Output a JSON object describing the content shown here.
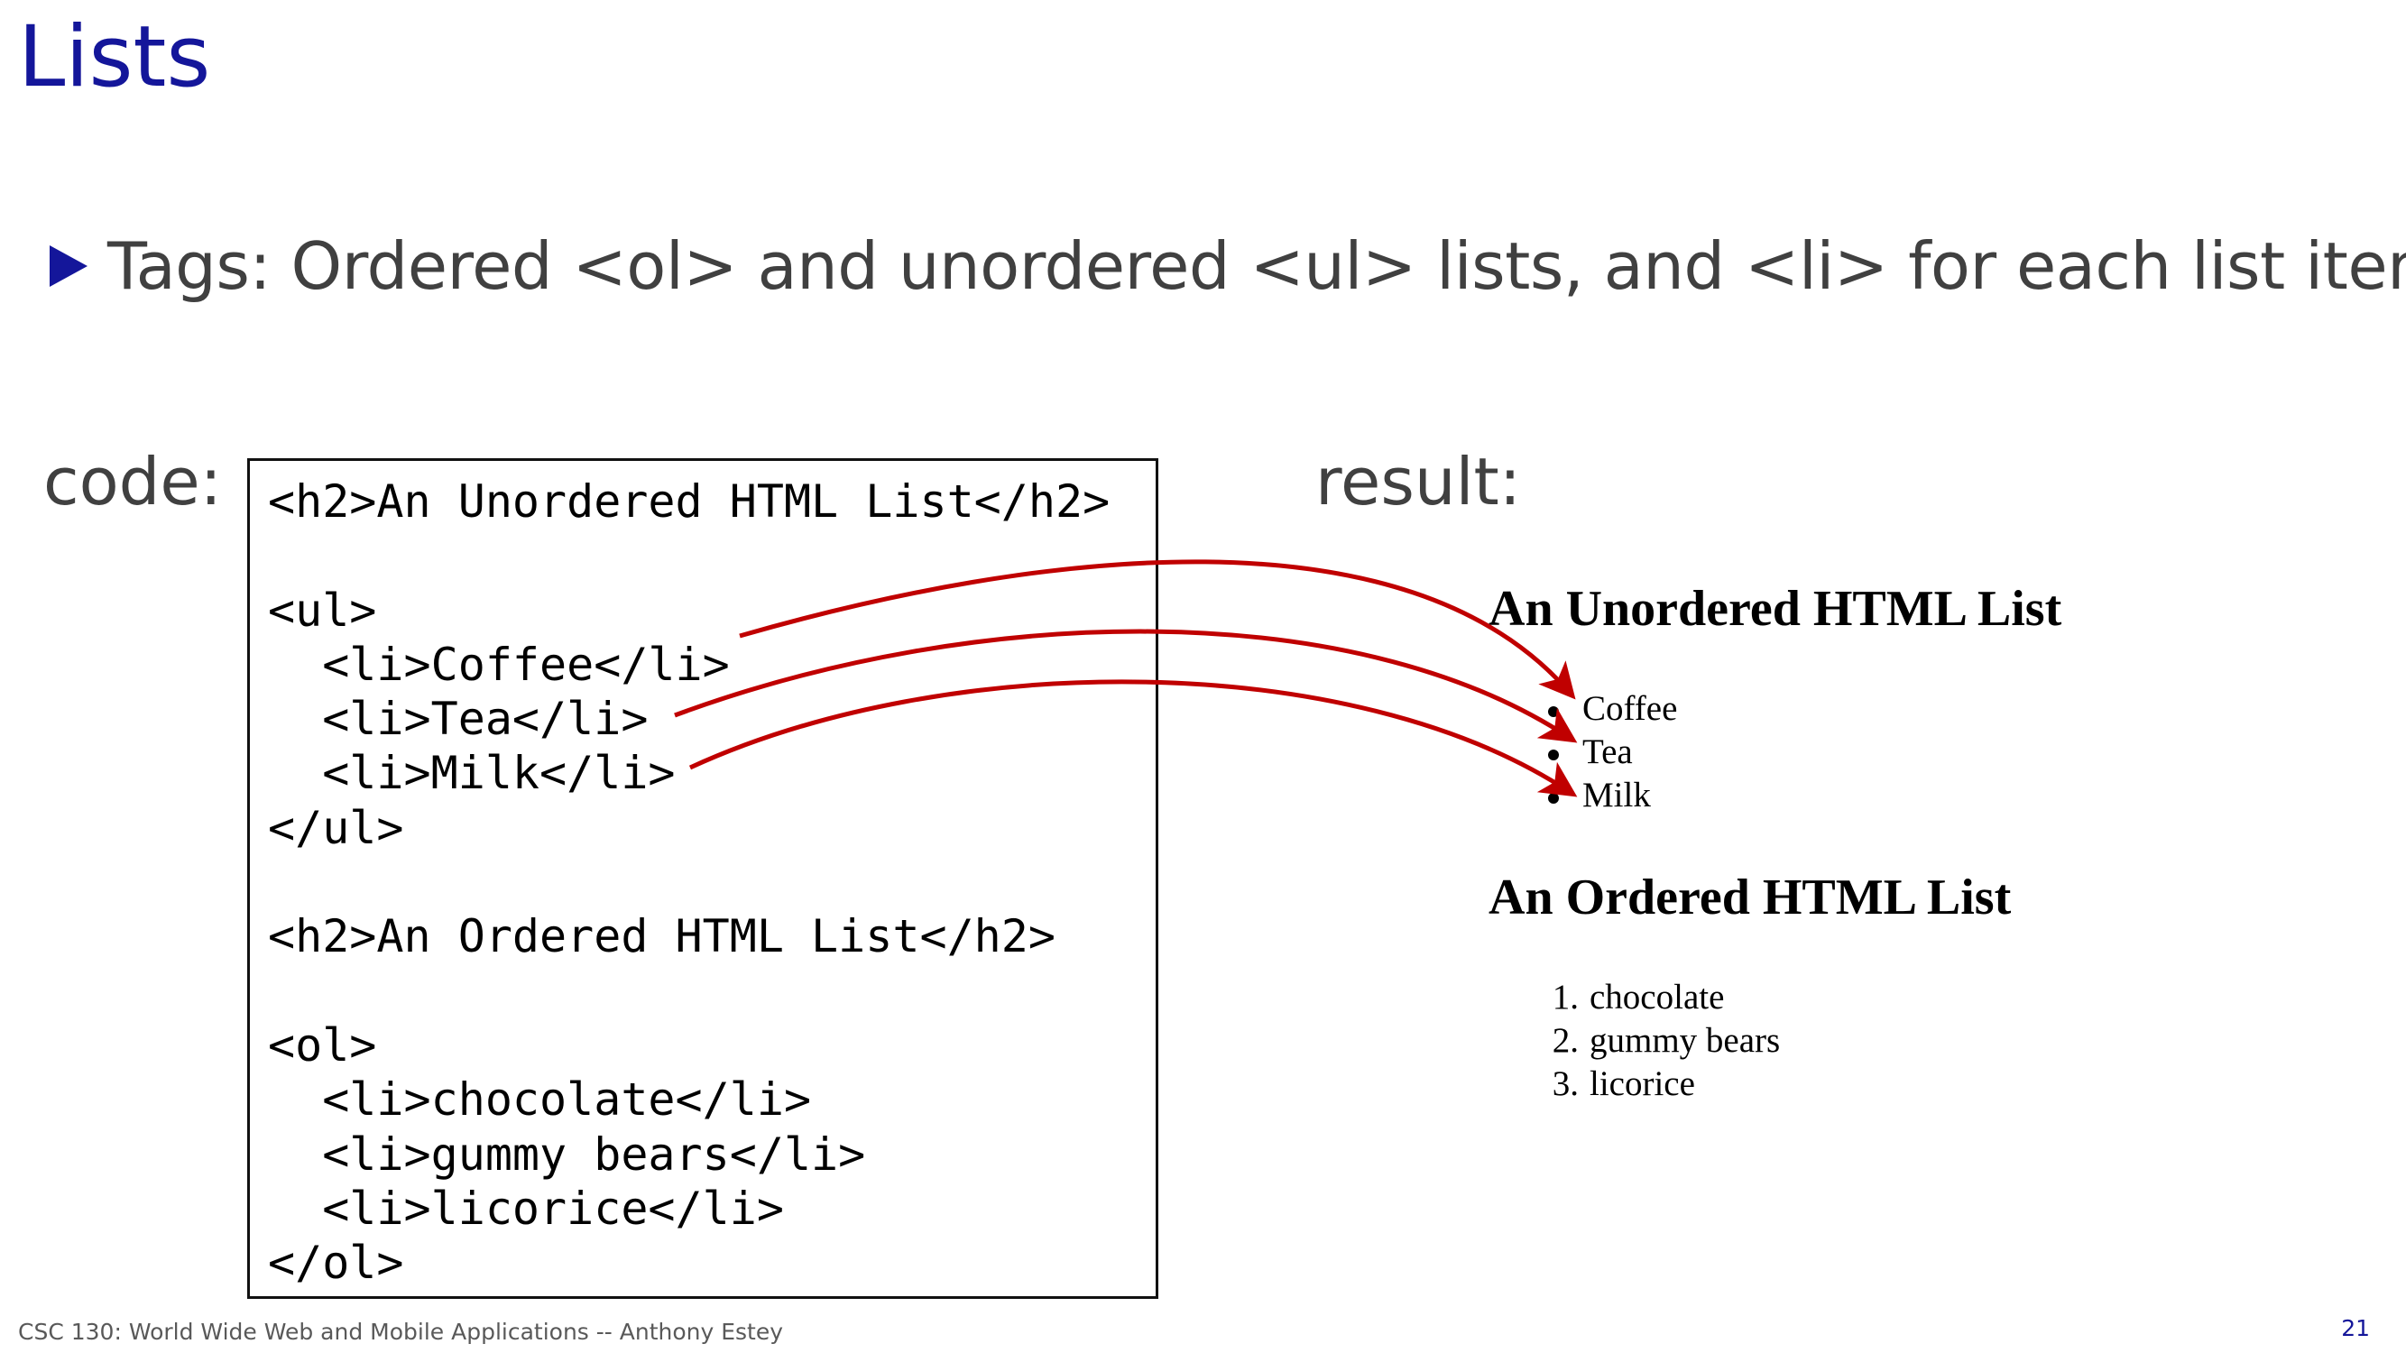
{
  "slide": {
    "title": "Lists",
    "bullet": "Tags: Ordered <ol> and unordered <ul> lists, and <li> for each list item",
    "code_label": "code:",
    "result_label": "result:"
  },
  "code_lines": [
    "<h2>An Unordered HTML List</h2>",
    "",
    "<ul>",
    "  <li>Coffee</li>",
    "  <li>Tea</li>",
    "  <li>Milk</li>",
    "</ul>",
    "",
    "<h2>An Ordered HTML List</h2>",
    "",
    "<ol>",
    "  <li>chocolate</li>",
    "  <li>gummy bears</li>",
    "  <li>licorice</li>",
    "</ol>"
  ],
  "result": {
    "ul_heading": "An Unordered HTML List",
    "ul_items": [
      "Coffee",
      "Tea",
      "Milk"
    ],
    "ol_heading": "An Ordered HTML List",
    "ol_items": [
      "chocolate",
      "gummy bears",
      "licorice"
    ],
    "ol_numbers": [
      "1.",
      "2.",
      "3."
    ]
  },
  "footer": {
    "course": "CSC 130: World Wide Web and Mobile Applications -- Anthony Estey",
    "page_number": "21"
  },
  "colors": {
    "title": "#14169a",
    "body_text": "#404040",
    "arrow": "#c00000"
  }
}
